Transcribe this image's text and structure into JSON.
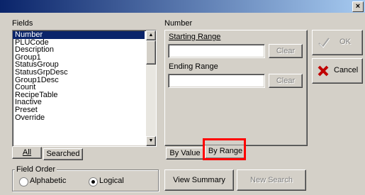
{
  "window": {
    "close_label": "×"
  },
  "fields": {
    "label": "Fields",
    "items": [
      "Number",
      "PLUCode",
      "Description",
      "Group1",
      "StatusGroup",
      "StatusGrpDesc",
      "Group1Desc",
      "Count",
      "RecipeTable",
      "Inactive",
      "Preset",
      "Override"
    ],
    "selected_index": 0,
    "tabs": [
      {
        "label": "All"
      },
      {
        "label": "Searched"
      }
    ]
  },
  "field_order": {
    "label": "Field Order",
    "options": [
      {
        "label": "Alphabetic",
        "checked": false
      },
      {
        "label": "Logical",
        "checked": true
      }
    ]
  },
  "criteria": {
    "title": "Number",
    "starting_label": "Starting Range",
    "starting_value": "",
    "ending_label": "Ending Range",
    "ending_value": "",
    "clear_label": "Clear",
    "tabs": [
      {
        "label": "By Value"
      },
      {
        "label": "By Range",
        "selected": true
      }
    ]
  },
  "buttons": {
    "ok": "OK",
    "cancel": "Cancel",
    "view_summary": "View Summary",
    "new_search": "New Search"
  },
  "colors": {
    "highlight_box": "#ff0000",
    "selection": "#0a246a"
  }
}
